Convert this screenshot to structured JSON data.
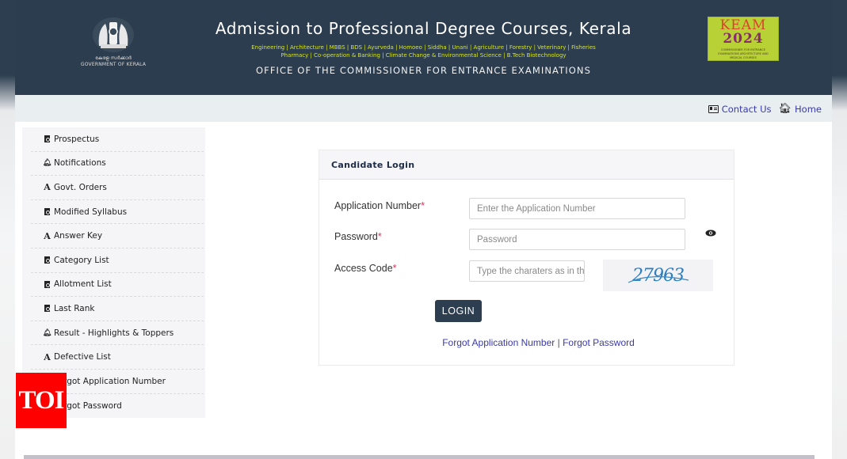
{
  "header": {
    "gov_logo_text_mal": "കേരള സർക്കാർ",
    "gov_logo_text_en": "GOVERNMENT OF KERALA",
    "title": "Admission to Professional Degree Courses, Kerala",
    "courses_line1": "Engineering | Architecture | MBBS | BDS | Ayurveda | Homoeo | Siddha | Unani | Agriculture | Forestry | Veterinary | Fisheries",
    "courses_line2": "Pharmacy | Co-operation & Banking | Climate Change & Environmental Science | B.Tech Biotechnology",
    "office": "OFFICE OF THE COMMISSIONER FOR ENTRANCE EXAMINATIONS",
    "keam_logo": {
      "line1": "KEAM",
      "line2": "2024",
      "tagline": "COMMISSIONER FOR ENTRANCE EXAMINATIONS ARCHITECTURE AND MEDICAL COURSES"
    }
  },
  "topbar": {
    "contact_label": "Contact Us",
    "contact_icon": "contact-card-icon",
    "home_label": "Home",
    "home_icon": "home-icon"
  },
  "sidebar": {
    "items": [
      {
        "label": "Prospectus",
        "icon": "pdf-file-icon"
      },
      {
        "label": "Notifications",
        "icon": "bell-icon"
      },
      {
        "label": "Govt. Orders",
        "icon": "font-a-icon"
      },
      {
        "label": "Modified Syllabus",
        "icon": "pdf-file-icon"
      },
      {
        "label": "Answer Key",
        "icon": "font-a-icon"
      },
      {
        "label": "Category List",
        "icon": "pdf-file-icon"
      },
      {
        "label": "Allotment List",
        "icon": "pdf-file-icon"
      },
      {
        "label": "Last Rank",
        "icon": "pdf-file-icon"
      },
      {
        "label": "Result - Highlights & Toppers",
        "icon": "bell-icon"
      },
      {
        "label": "Defective List",
        "icon": "font-a-icon"
      },
      {
        "label": "Forgot Application Number",
        "icon": "pdf-file-icon"
      },
      {
        "label": "Forgot Password",
        "icon": "pdf-file-icon"
      }
    ]
  },
  "watermark": {
    "text": "TOI"
  },
  "login": {
    "title": "Candidate Login",
    "fields": {
      "application_number": {
        "label": "Application Number",
        "required_mark": "*",
        "placeholder": "Enter the Application Number",
        "value": ""
      },
      "password": {
        "label": "Password",
        "required_mark": "*",
        "placeholder": "Password",
        "value": ""
      },
      "access_code": {
        "label": "Access Code",
        "required_mark": "*",
        "placeholder": "Type the charaters as in the image",
        "value": ""
      }
    },
    "captcha_text": "27963",
    "login_button": "LOGIN",
    "forgot_app_number": "Forgot Application Number",
    "separator": "|",
    "forgot_password": "Forgot Password"
  },
  "colors": {
    "header_bg": "#2c3d4f",
    "link": "#3a3aa8",
    "course_text": "#d8e614",
    "required": "#e0305a",
    "button_bg": "#2c3e50",
    "watermark_bg": "#ff0000"
  }
}
